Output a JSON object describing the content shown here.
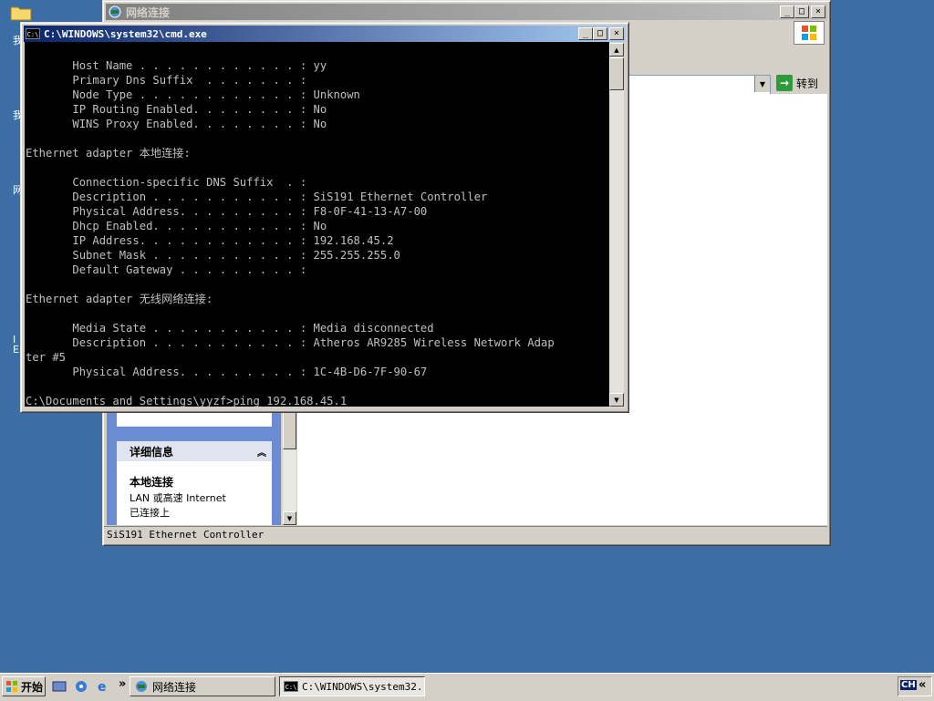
{
  "desktop": {
    "icon_labels": [
      "我",
      "我",
      "网",
      "I",
      "E"
    ]
  },
  "explorer": {
    "title": "网络连接",
    "go_label": "转到",
    "details_header": "详细信息",
    "details_name": "本地连接",
    "details_type": "LAN 或高速 Internet",
    "details_status": "已连接上",
    "status_text": "SiS191 Ethernet Controller"
  },
  "cmd": {
    "title": "C:\\WINDOWS\\system32\\cmd.exe",
    "lines": [
      "       Host Name . . . . . . . . . . . . : yy",
      "       Primary Dns Suffix  . . . . . . . :",
      "       Node Type . . . . . . . . . . . . : Unknown",
      "       IP Routing Enabled. . . . . . . . : No",
      "       WINS Proxy Enabled. . . . . . . . : No",
      "",
      "Ethernet adapter 本地连接:",
      "",
      "       Connection-specific DNS Suffix  . :",
      "       Description . . . . . . . . . . . : SiS191 Ethernet Controller",
      "       Physical Address. . . . . . . . . : F8-0F-41-13-A7-00",
      "       Dhcp Enabled. . . . . . . . . . . : No",
      "       IP Address. . . . . . . . . . . . : 192.168.45.2",
      "       Subnet Mask . . . . . . . . . . . : 255.255.255.0",
      "       Default Gateway . . . . . . . . . :",
      "",
      "Ethernet adapter 无线网络连接:",
      "",
      "       Media State . . . . . . . . . . . : Media disconnected",
      "       Description . . . . . . . . . . . : Atheros AR9285 Wireless Network Adap",
      "ter #5",
      "       Physical Address. . . . . . . . . : 1C-4B-D6-7F-90-67",
      "",
      "C:\\Documents and Settings\\yyzf>ping 192.168.45.1"
    ]
  },
  "taskbar": {
    "start_label": "开始",
    "task_explorer": "网络连接",
    "task_cmd": "C:\\WINDOWS\\system32...",
    "chevron": "»",
    "tray_ime": "CH",
    "tray_arrow": "«"
  },
  "colors": {
    "desktop": "#3a6ea5",
    "title_active": "#0a246a",
    "title_inactive": "#808080"
  },
  "icons": [
    "folder-icon",
    "network-icon",
    "cmd-icon",
    "windows-logo-icon",
    "go-arrow-icon",
    "start-flag-icon",
    "ie-icon",
    "media-icon",
    "desktop-icon"
  ]
}
